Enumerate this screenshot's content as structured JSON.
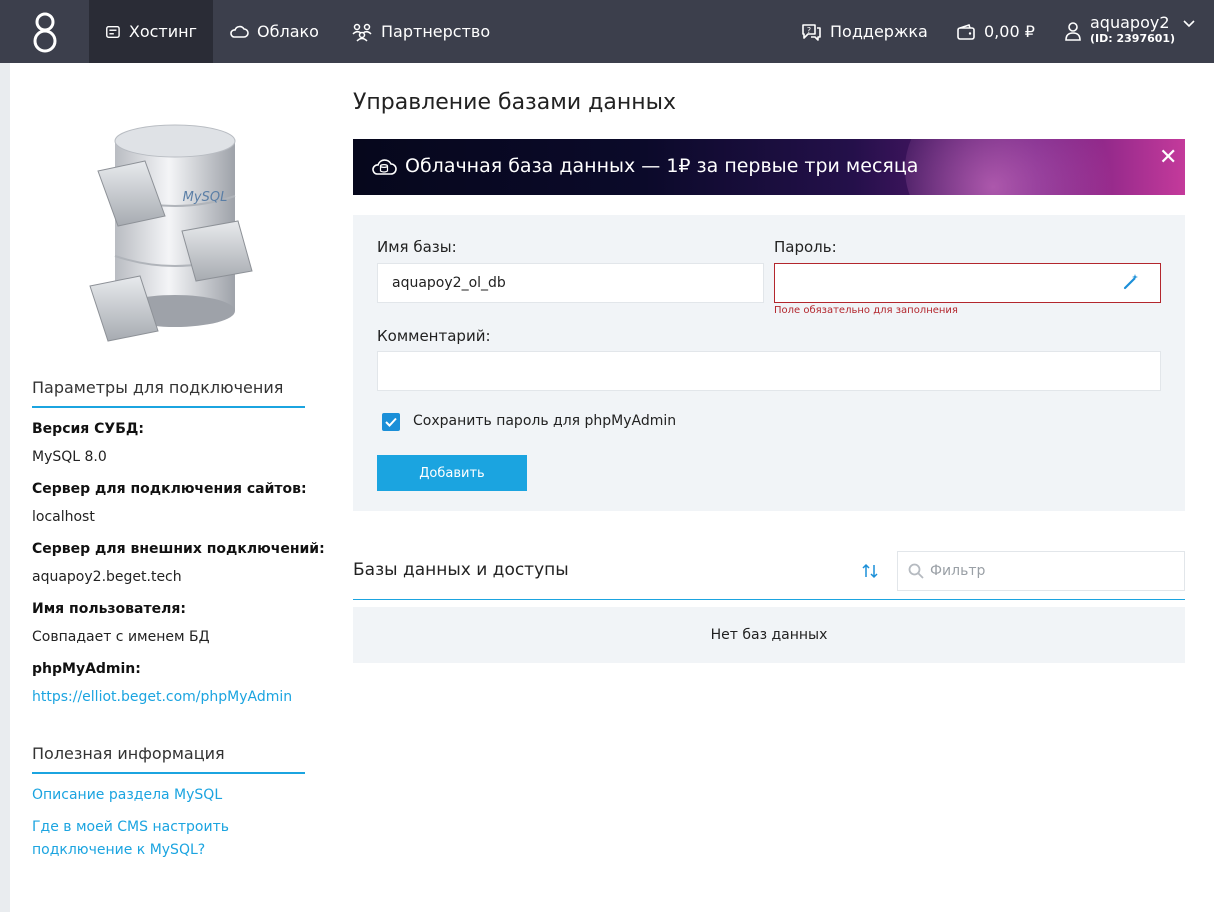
{
  "topbar": {
    "logo_icon": "beget-logo-icon",
    "nav": [
      {
        "label": "Хостинг",
        "icon": "hosting-icon"
      },
      {
        "label": "Облако",
        "icon": "cloud-icon"
      },
      {
        "label": "Партнерство",
        "icon": "partners-icon"
      }
    ],
    "support_label": "Поддержка",
    "balance": "0,00 ₽",
    "user": {
      "name": "aquapoy2",
      "id": "(ID: 2397601)"
    }
  },
  "sidebar": {
    "illustration_text": "MySQL",
    "connection_title": "Параметры для подключения",
    "params": [
      {
        "label": "Версия СУБД:",
        "value": "MySQL 8.0"
      },
      {
        "label": "Сервер для подключения сайтов:",
        "value": "localhost"
      },
      {
        "label": "Сервер для внешних подключений:",
        "value": "aquapoy2.beget.tech"
      },
      {
        "label": "Имя пользователя:",
        "value": "Совпадает с именем БД"
      },
      {
        "label": "phpMyAdmin:",
        "value": "https://elliot.beget.com/phpMyAdmin"
      }
    ],
    "info_title": "Полезная информация",
    "links": [
      "Описание раздела MySQL",
      "Где в моей CMS настроить подключение к MySQL?"
    ]
  },
  "main": {
    "title": "Управление базами данных",
    "banner": {
      "text": "Облачная база данных — 1₽ за первые три месяца",
      "close": "✕"
    },
    "form": {
      "db_name_label": "Имя базы:",
      "db_name_value": "aquapoy2_ol_db",
      "password_label": "Пароль:",
      "password_value": "",
      "password_error": "Поле обязательно для заполнения",
      "comment_label": "Комментарий:",
      "comment_value": "",
      "save_password_label": "Сохранить пароль для phpMyAdmin",
      "save_password_checked": true,
      "add_button": "Добавить"
    },
    "list": {
      "title": "Базы данных и доступы",
      "filter_placeholder": "Фильтр",
      "empty_text": "Нет баз данных"
    }
  },
  "colors": {
    "topbar": "#3c3f4c",
    "accent": "#1ba4e0",
    "error": "#b3262d",
    "panel": "#f1f4f7"
  }
}
